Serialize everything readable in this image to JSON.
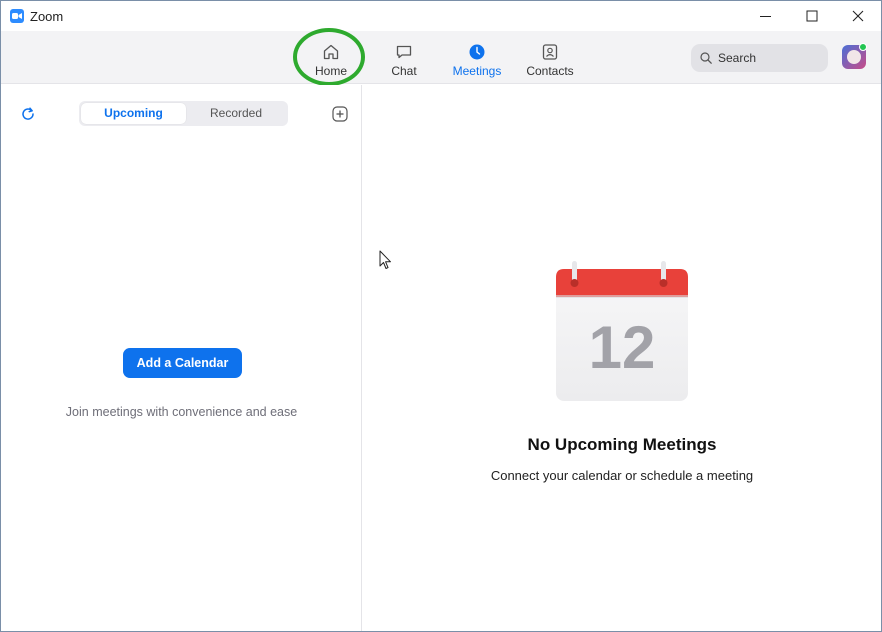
{
  "window": {
    "title": "Zoom"
  },
  "toolbar": {
    "tabs": [
      {
        "id": "home",
        "label": "Home",
        "icon": "home-icon"
      },
      {
        "id": "chat",
        "label": "Chat",
        "icon": "chat-bubble-icon"
      },
      {
        "id": "meetings",
        "label": "Meetings",
        "icon": "clock-icon",
        "active": true
      },
      {
        "id": "contacts",
        "label": "Contacts",
        "icon": "contact-card-icon"
      }
    ],
    "search_placeholder": "Search",
    "presence_color": "#23c552"
  },
  "left_panel": {
    "segments": [
      {
        "label": "Upcoming",
        "selected": true
      },
      {
        "label": "Recorded",
        "selected": false
      }
    ],
    "add_calendar_label": "Add a Calendar",
    "hint": "Join meetings with convenience and ease"
  },
  "right_panel": {
    "calendar_day": "12",
    "empty_title": "No Upcoming Meetings",
    "empty_subtitle": "Connect your calendar or schedule a meeting"
  },
  "colors": {
    "accent": "#0e72ed",
    "highlight_ring": "#2eaa2e",
    "calendar_header": "#e8413a"
  }
}
